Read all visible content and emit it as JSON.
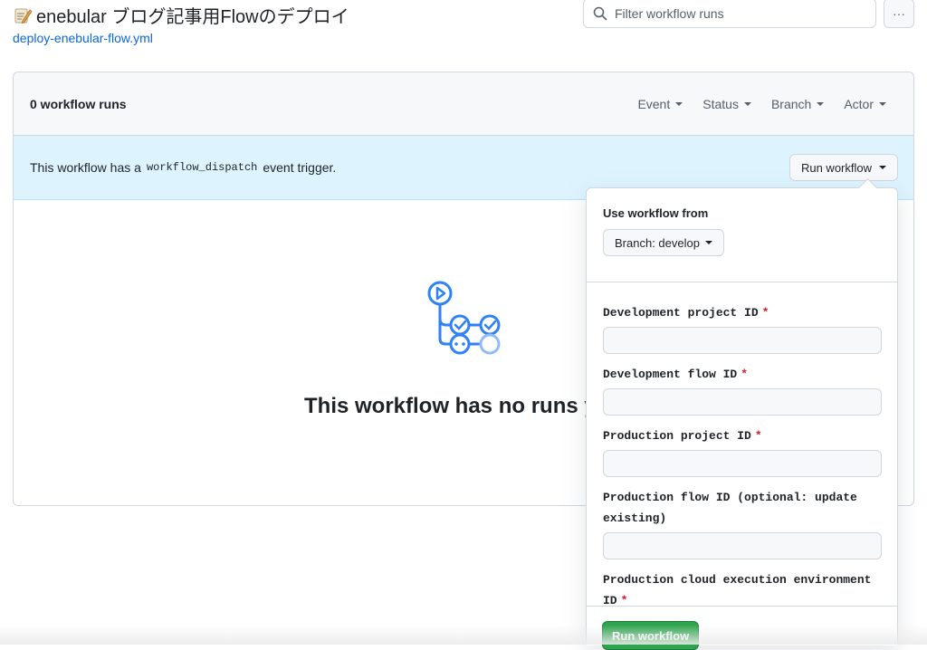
{
  "header": {
    "title": "enebular ブログ記事用Flowのデプロイ",
    "title_icon": "memo-icon",
    "file_link": "deploy-enebular-flow.yml",
    "filter_placeholder": "Filter workflow runs",
    "more_label": "···"
  },
  "runs": {
    "count_label": "0 workflow runs",
    "filters": [
      "Event",
      "Status",
      "Branch",
      "Actor"
    ]
  },
  "dispatch": {
    "text_before": "This workflow has a",
    "code": "workflow_dispatch",
    "text_after": "event trigger.",
    "button_label": "Run workflow"
  },
  "empty_state": {
    "title": "This workflow has no runs y"
  },
  "popover": {
    "use_from_label": "Use workflow from",
    "branch_label": "Branch: develop",
    "fields": [
      {
        "label": "Development project ID",
        "required": "*"
      },
      {
        "label": "Development flow ID",
        "required": "*"
      },
      {
        "label": "Production project ID",
        "required": "*"
      },
      {
        "label": "Production flow ID (optional: update existing)",
        "required": ""
      },
      {
        "label": "Production cloud execution environment ID",
        "required": "*"
      }
    ],
    "submit_label": "Run workflow"
  },
  "colors": {
    "accent_blue": "#0969da",
    "dispatch_bg": "#ddf4ff",
    "run_green": "#2da44e",
    "required_red": "#cf222e",
    "graphic_blue": "#2f81f7"
  }
}
